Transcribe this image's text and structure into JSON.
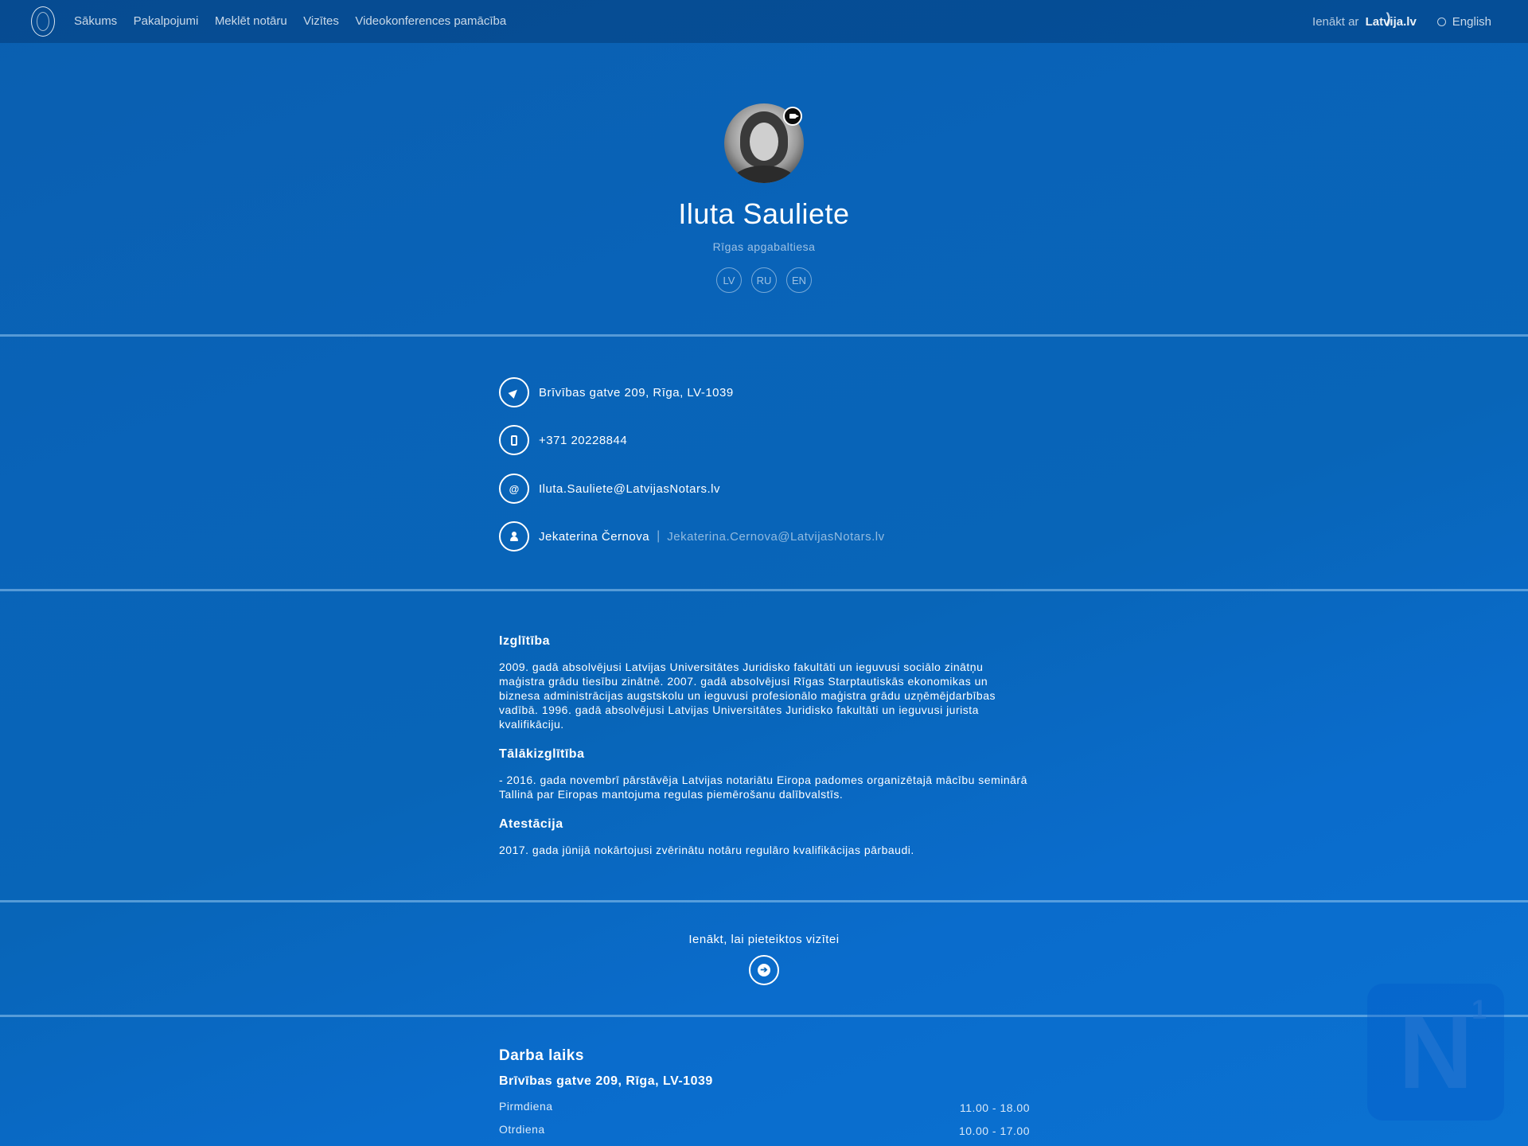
{
  "nav": {
    "items": [
      "Sākums",
      "Pakalpojumi",
      "Meklēt notāru",
      "Vizītes",
      "Videokonferences pamācība"
    ],
    "login_label": "Ienākt ar",
    "login_brand": "Latvija.lv",
    "language": "English"
  },
  "profile": {
    "name": "Iluta Sauliete",
    "court": "Rīgas apgabaltiesa",
    "languages": [
      "LV",
      "RU",
      "EN"
    ]
  },
  "contacts": {
    "address": "Brīvības gatve 209, Rīga, LV-1039",
    "phone": "+371 20228844",
    "email": "Iluta.Sauliete@LatvijasNotars.lv",
    "assistant_name": "Jekaterina Černova",
    "assistant_separator": "|",
    "assistant_email": "Jekaterina.Cernova@LatvijasNotars.lv"
  },
  "bio": {
    "education_title": "Izglītība",
    "education_text": "2009. gadā absolvējusi Latvijas Universitātes Juridisko fakultāti un ieguvusi sociālo zinātņu maģistra grādu tiesību zinātnē. 2007. gadā absolvējusi Rīgas Starptautiskās ekonomikas un biznesa administrācijas augstskolu un ieguvusi profesionālo maģistra grādu uzņēmējdarbības vadībā. 1996. gadā absolvējusi Latvijas Universitātes Juridisko fakultāti un ieguvusi jurista kvalifikāciju.",
    "further_title": "Tālākizglītība",
    "further_text": "- 2016. gada novembrī pārstāvēja Latvijas notariātu Eiropa padomes organizētajā mācību seminārā Tallinā par Eiropas mantojuma regulas piemērošanu dalībvalstīs.",
    "attestation_title": "Atestācija",
    "attestation_text": "2017. gada jūnijā nokārtojusi zvērinātu notāru regulāro kvalifikācijas pārbaudi."
  },
  "visit": {
    "label": "Ienākt, lai pieteiktos vizītei"
  },
  "hours": {
    "title": "Darba laiks",
    "address": "Brīvības gatve 209, Rīga, LV-1039",
    "rows": [
      {
        "day": "Pirmdiena",
        "time": "11.00 - 18.00"
      },
      {
        "day": "Otrdiena",
        "time": "10.00 - 17.00"
      }
    ]
  },
  "watermark": {
    "letter": "N",
    "superscript": "1"
  },
  "colors": {
    "background": "#0865b8",
    "divider": "#96c8f0"
  }
}
